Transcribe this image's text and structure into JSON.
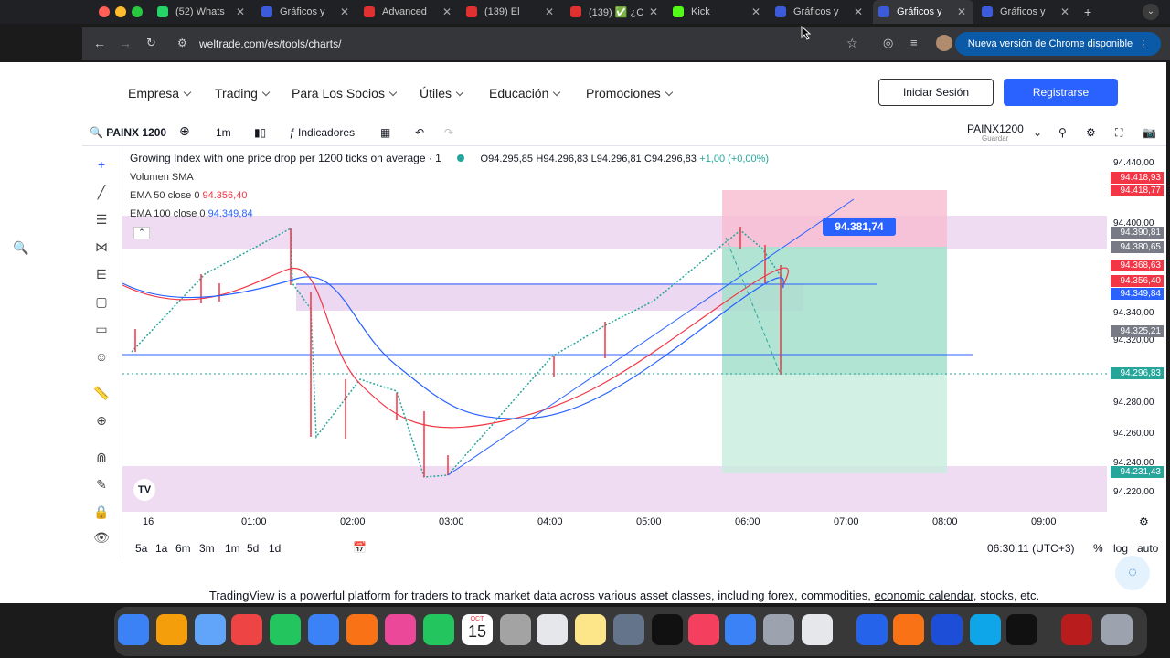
{
  "browser": {
    "tabs": [
      {
        "label": "(52) Whats",
        "color": "#25d366"
      },
      {
        "label": "Gráficos y",
        "color": "#3b5bdb"
      },
      {
        "label": "Advanced",
        "color": "#e03131"
      },
      {
        "label": "(139) El",
        "color": "#e03131"
      },
      {
        "label": "(139) ✅ ¿C",
        "color": "#e03131"
      },
      {
        "label": "Kick",
        "color": "#53fc18"
      },
      {
        "label": "Gráficos y",
        "color": "#3b5bdb"
      },
      {
        "label": "Gráficos y",
        "color": "#3b5bdb"
      },
      {
        "label": "Gráficos y",
        "color": "#3b5bdb"
      }
    ],
    "url": "weltrade.com/es/tools/charts/",
    "update_label": "Nueva versión de Chrome disponible"
  },
  "site_nav": {
    "items": [
      "Empresa",
      "Trading",
      "Para Los Socios",
      "Útiles",
      "Educación",
      "Promociones"
    ],
    "login": "Iniciar Sesión",
    "register": "Registrarse"
  },
  "toolbar": {
    "symbol": "PAINX 1200",
    "interval": "1m",
    "indicators": "Indicadores",
    "symbol_right": "PAINX1200",
    "save_label": "Guardar"
  },
  "legend": {
    "title": "Growing Index with one price drop per 1200 ticks on average · 1",
    "o": "O94.295,85",
    "h": "H94.296,83",
    "l": "L94.296,81",
    "c": "C94.296,83",
    "chg": "+1,00 (+0,00%)",
    "volume": "Volumen SMA",
    "ema50_label": "EMA 50 close 0",
    "ema50_value": "94.356,40",
    "ema100_label": "EMA 100 close 0",
    "ema100_value": "94.349,84"
  },
  "chart_data": {
    "type": "line",
    "x_ticks": [
      "16",
      "01:00",
      "02:00",
      "03:00",
      "04:00",
      "05:00",
      "06:00",
      "07:00",
      "08:00",
      "09:00"
    ],
    "y_ticks": [
      "94.440,00",
      "94.400,00",
      "94.340,00",
      "94.320,00",
      "94.280,00",
      "94.260,00",
      "94.240,00",
      "94.220,00"
    ],
    "price_badges": [
      {
        "label": "94.418,93",
        "color": "#f23645"
      },
      {
        "label": "94.418,77",
        "color": "#f23645"
      },
      {
        "label": "94.390,81",
        "color": "#787b86"
      },
      {
        "label": "94.380,65",
        "color": "#787b86"
      },
      {
        "label": "94.368,63",
        "color": "#f23645"
      },
      {
        "label": "94.356,40",
        "color": "#f23645"
      },
      {
        "label": "94.349,84",
        "color": "#2962ff"
      },
      {
        "label": "94.325,21",
        "color": "#787b86"
      },
      {
        "label": "94.296,83",
        "color": "#26a69a"
      },
      {
        "label": "94.231,43",
        "color": "#26a69a"
      }
    ],
    "crosshair_label": "94.381,74"
  },
  "bottom": {
    "ranges": [
      "5a",
      "1a",
      "6m",
      "3m",
      "1m",
      "5d",
      "1d"
    ],
    "time": "06:30:11 (UTC+3)",
    "pct": "%",
    "log": "log",
    "auto": "auto"
  },
  "footer": {
    "text_before": "TradingView is a powerful platform for traders to track market data across various asset classes, including forex, commodities, ",
    "link": "economic calendar",
    "text_after": ", stocks, etc."
  },
  "dock": {
    "calendar_month": "OCT",
    "calendar_day": "15"
  }
}
